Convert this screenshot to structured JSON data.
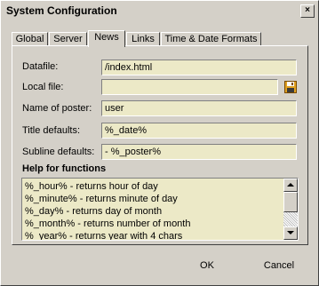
{
  "window": {
    "title": "System Configuration",
    "close_glyph": "×"
  },
  "tabs": [
    {
      "label": "Global",
      "active": false
    },
    {
      "label": "Server",
      "active": false
    },
    {
      "label": "News",
      "active": true
    },
    {
      "label": "Links",
      "active": false
    },
    {
      "label": "Time & Date Formats",
      "active": false
    }
  ],
  "form": {
    "datafile": {
      "label": "Datafile:",
      "value": "/index.html"
    },
    "local_file": {
      "label": "Local file:",
      "value": ""
    },
    "poster_name": {
      "label": "Name of poster:",
      "value": "user"
    },
    "title_defaults": {
      "label": "Title defaults:",
      "value": "%_date%"
    },
    "subline_defaults": {
      "label": "Subline defaults:",
      "value": "- %_poster%"
    }
  },
  "help": {
    "title": "Help for functions",
    "items": [
      "%_hour% - returns hour of day",
      "%_minute% - returns minute of day",
      "%_day% - returns day of month",
      "%_month% - returns number of month",
      "%_year% - returns year with 4 chars"
    ]
  },
  "buttons": {
    "ok": "OK",
    "cancel": "Cancel"
  },
  "icons": {
    "browse": "floppy-disk-icon",
    "close": "close-icon",
    "scroll_up": "arrow-up-icon",
    "scroll_down": "arrow-down-icon"
  }
}
